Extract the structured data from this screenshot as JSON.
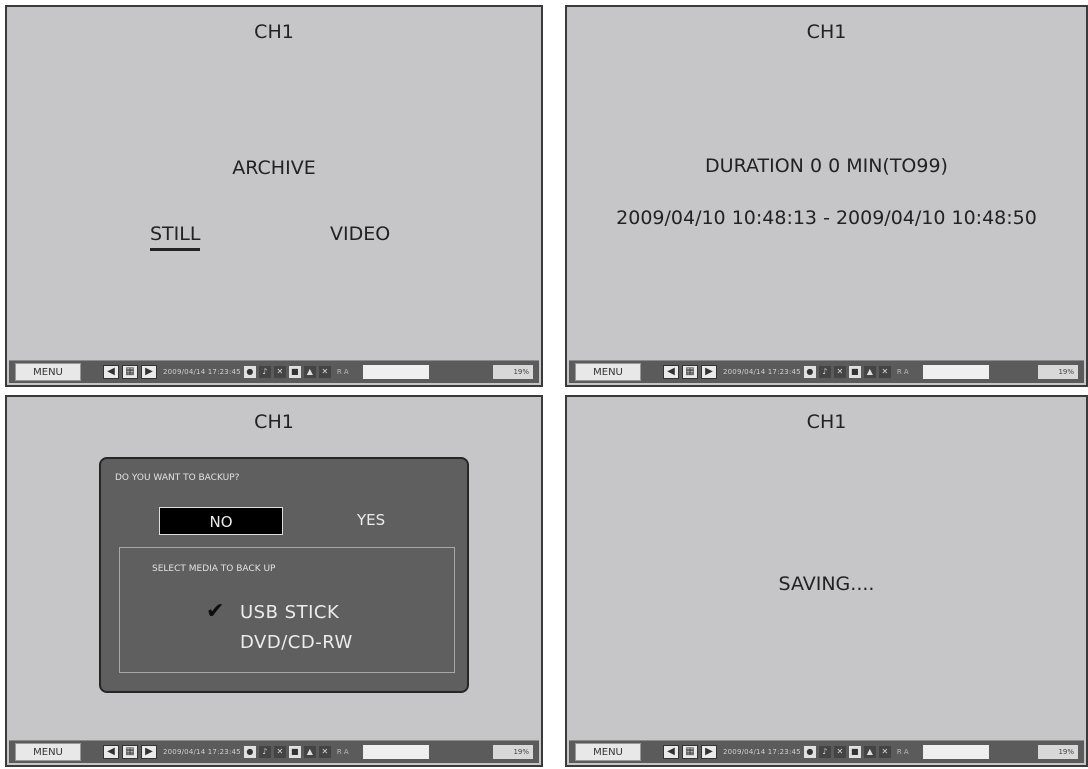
{
  "screens": [
    {
      "channel": "CH1",
      "heading": "ARCHIVE",
      "options": [
        "STILL",
        "VIDEO"
      ],
      "selected_option": "STILL"
    },
    {
      "channel": "CH1",
      "duration_text": "DURATION 0 0 MIN(TO99)",
      "time_range_text": "2009/04/10 10:48:13 - 2009/04/10 10:48:50"
    },
    {
      "channel": "CH1",
      "dialog": {
        "question": "DO YOU WANT TO BACKUP?",
        "no_label": "NO",
        "yes_label": "YES",
        "media_title": "SELECT MEDIA TO BACK UP",
        "check_icon": "✔",
        "media_options": [
          "USB STICK",
          "DVD/CD-RW"
        ],
        "selected_media": "USB STICK"
      }
    },
    {
      "channel": "CH1",
      "status_message": "SAVING...."
    }
  ],
  "status_bar": {
    "menu_label": "MENU",
    "date_text": "2009/04/14 17:23:45",
    "tiny_text": "R A",
    "percent": "19%",
    "icons": [
      "arrow-left-icon",
      "grid-icon",
      "arrow-right-icon"
    ]
  }
}
